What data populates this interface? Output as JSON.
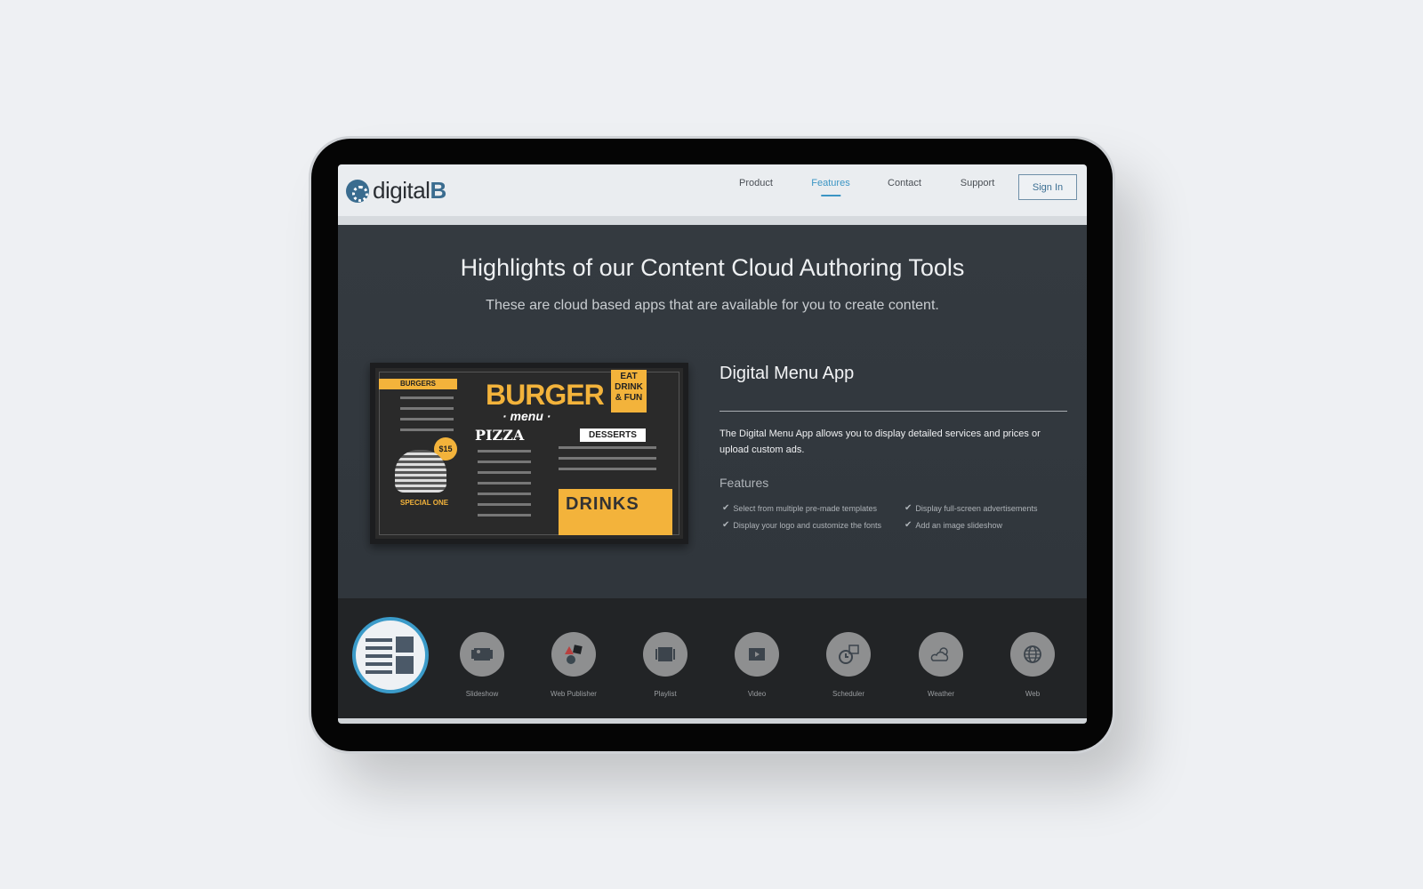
{
  "nav": {
    "logo": {
      "prefix": "digital",
      "suffix": "B"
    },
    "links": [
      {
        "label": "Product",
        "active": false
      },
      {
        "label": "Features",
        "active": true
      },
      {
        "label": "Contact",
        "active": false
      },
      {
        "label": "Support",
        "active": false
      }
    ],
    "sign_in": "Sign In"
  },
  "hero": {
    "title": "Highlights of our Content Cloud Authoring Tools",
    "subtitle": "These are cloud based apps that are available for you to create content."
  },
  "menu_image": {
    "burgers": "BURGERS",
    "burger": "BURGER",
    "menu": "· menu ·",
    "eat": "EAT DRINK & FUN",
    "pizza": "PIZZA",
    "desserts": "DESSERTS",
    "price": "$15",
    "special": "SPECIAL ONE",
    "drinks": "DRINKS"
  },
  "app": {
    "title": "Digital Menu App",
    "description": "The Digital Menu App allows you to display detailed services and prices or upload custom ads.",
    "features_heading": "Features",
    "features": [
      "Select from multiple pre-made templates",
      "Display your logo and customize the fonts",
      "Display full-screen advertisements",
      "Add an image slideshow"
    ]
  },
  "apps": [
    {
      "label": "Slideshow",
      "icon": "slideshow-icon"
    },
    {
      "label": "Web Publisher",
      "icon": "shapes-icon"
    },
    {
      "label": "Playlist",
      "icon": "playlist-icon"
    },
    {
      "label": "Video",
      "icon": "film-icon"
    },
    {
      "label": "Scheduler",
      "icon": "clock-calendar-icon"
    },
    {
      "label": "Weather",
      "icon": "sun-cloud-icon"
    },
    {
      "label": "Web",
      "icon": "globe-icon"
    }
  ],
  "colors": {
    "accent": "#3b95c4",
    "menu_yellow": "#f3b33b",
    "brand": "#3a6c8f"
  }
}
